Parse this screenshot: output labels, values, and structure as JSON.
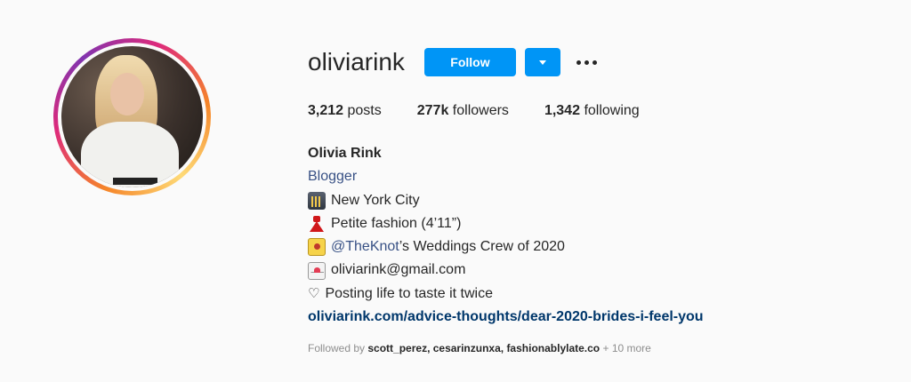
{
  "profile": {
    "username": "oliviarink",
    "follow_label": "Follow",
    "stats": {
      "posts_count": "3,212",
      "posts_label": "posts",
      "followers_count": "277k",
      "followers_label": "followers",
      "following_count": "1,342",
      "following_label": "following"
    }
  },
  "bio": {
    "name": "Olivia Rink",
    "category": "Blogger",
    "location": "New York City",
    "fashion": "Petite fashion (4’11”)",
    "mention": "@TheKnot",
    "mention_suffix": "’s Weddings Crew of 2020",
    "email": "oliviarink@gmail.com",
    "heart": "♡",
    "tagline": "Posting life to taste it twice",
    "link": "oliviarink.com/advice-thoughts/dear-2020-brides-i-feel-you"
  },
  "followed_by": {
    "prefix": "Followed by",
    "users": "scott_perez, cesarinzunxa, fashionablylate.co",
    "more": "+ 10 more"
  },
  "icons": {
    "city": "night-city-icon",
    "dress": "dress-icon",
    "knot": "medal-icon",
    "mail": "love-letter-icon",
    "more": "more-options-icon",
    "dropdown": "chevron-down-icon"
  },
  "colors": {
    "follow_button": "#0095f6",
    "link": "#00376b",
    "mention": "#385185",
    "muted": "#8e8e8e"
  }
}
